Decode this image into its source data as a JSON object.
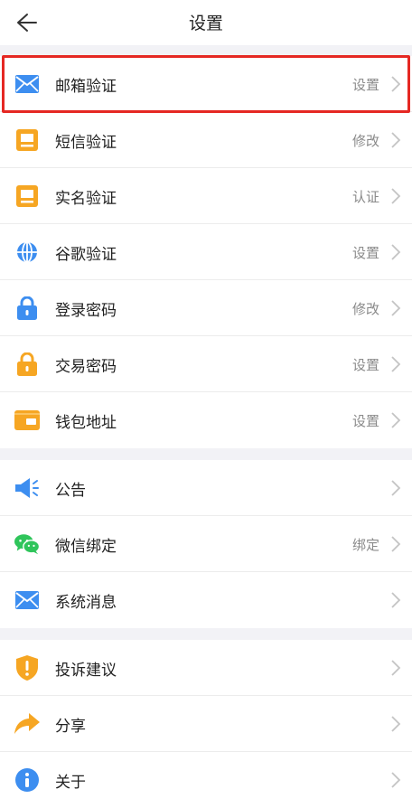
{
  "header": {
    "title": "设置"
  },
  "groups": [
    {
      "items": [
        {
          "label": "邮箱验证",
          "value": "设置",
          "icon": "mail-icon"
        },
        {
          "label": "短信验证",
          "value": "修改",
          "icon": "sms-icon"
        },
        {
          "label": "实名验证",
          "value": "认证",
          "icon": "id-card-icon"
        },
        {
          "label": "谷歌验证",
          "value": "设置",
          "icon": "globe-icon"
        },
        {
          "label": "登录密码",
          "value": "修改",
          "icon": "lock-icon"
        },
        {
          "label": "交易密码",
          "value": "设置",
          "icon": "lock-orange-icon"
        },
        {
          "label": "钱包地址",
          "value": "设置",
          "icon": "wallet-icon"
        }
      ]
    },
    {
      "items": [
        {
          "label": "公告",
          "value": "",
          "icon": "megaphone-icon"
        },
        {
          "label": "微信绑定",
          "value": "绑定",
          "icon": "wechat-icon"
        },
        {
          "label": "系统消息",
          "value": "",
          "icon": "message-icon"
        }
      ]
    },
    {
      "items": [
        {
          "label": "投诉建议",
          "value": "",
          "icon": "shield-alert-icon"
        },
        {
          "label": "分享",
          "value": "",
          "icon": "share-icon"
        },
        {
          "label": "关于",
          "value": "",
          "icon": "info-icon"
        }
      ]
    }
  ],
  "colors": {
    "blue": "#3d8ef0",
    "orange": "#f6a623",
    "green": "#2fc55b",
    "highlight": "#e52823"
  }
}
